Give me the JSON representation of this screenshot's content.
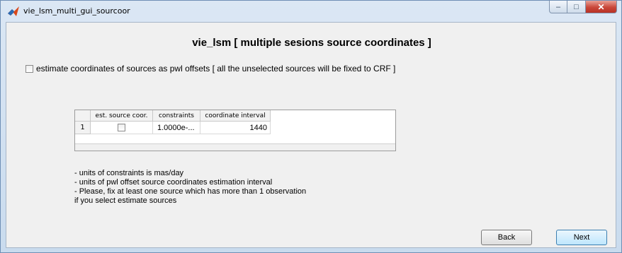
{
  "window": {
    "title": "vie_lsm_multi_gui_sourcoor",
    "minimize_icon": "minimize-icon",
    "maximize_icon": "maximize-icon",
    "close_icon": "close-icon",
    "minimize_glyph": "–",
    "maximize_glyph": "□",
    "close_glyph": "✕"
  },
  "heading": "vie_lsm [ multiple sesions source coordinates ]",
  "estimate_checkbox": {
    "label": "estimate coordinates of sources as pwl offsets [ all the unselected sources will be fixed to CRF ]",
    "checked": false
  },
  "table": {
    "columns": [
      "est. source coor.",
      "constraints",
      "coordinate interval"
    ],
    "rows": [
      {
        "row_label": "1",
        "est_source_coor": false,
        "constraints": "1.0000e-...",
        "coordinate_interval": "1440"
      }
    ]
  },
  "notes": [
    "- units of constraints is mas/day",
    "- units of pwl offset source coordinates estimation interval",
    "- Please, fix at least one source which has more than 1 observation",
    "if you select estimate sources"
  ],
  "buttons": {
    "back": "Back",
    "next": "Next"
  }
}
